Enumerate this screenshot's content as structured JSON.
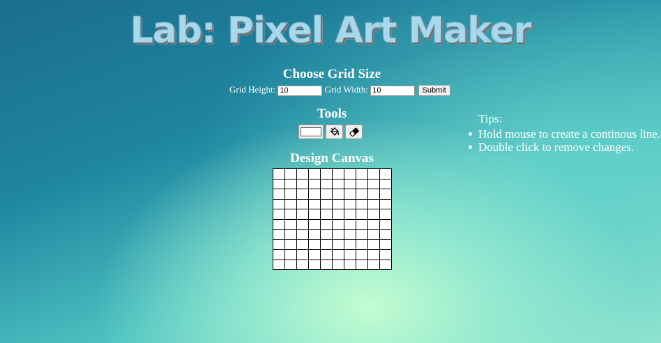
{
  "title": "Lab: Pixel Art Maker",
  "grid_size": {
    "heading": "Choose Grid Size",
    "height_label": "Grid Height:",
    "height_value": "10",
    "width_label": "Grid Width:",
    "width_value": "10",
    "submit_label": "Submit"
  },
  "tools": {
    "heading": "Tools",
    "items": [
      {
        "name": "color-picker",
        "icon": "color-swatch-icon",
        "value": "#ffffff"
      },
      {
        "name": "fill",
        "icon": "paint-bucket-icon"
      },
      {
        "name": "eraser",
        "icon": "eraser-icon"
      }
    ]
  },
  "canvas": {
    "heading": "Design Canvas",
    "rows": 10,
    "columns": 10
  },
  "tips": {
    "heading": "Tips:",
    "items": [
      "Hold mouse to create a continous line.",
      "Double click to remove changes."
    ]
  }
}
